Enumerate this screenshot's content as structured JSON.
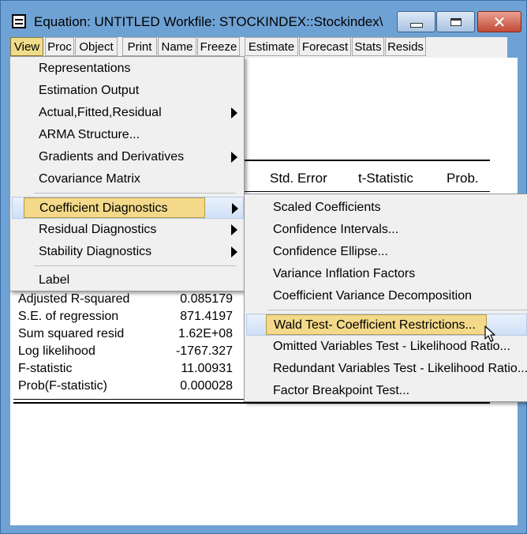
{
  "window": {
    "title": "Equation: UNTITLED   Workfile: STOCKINDEX::Stockindex\\"
  },
  "toolbar": {
    "buttons": [
      "View",
      "Proc",
      "Object",
      "Print",
      "Name",
      "Freeze",
      "Estimate",
      "Forecast",
      "Stats",
      "Resids"
    ],
    "active": "View"
  },
  "table": {
    "headers": [
      "Std. Error",
      "t-Statistic",
      "Prob."
    ],
    "stats": [
      {
        "label": "Adjusted R-squared",
        "value": "0.085179"
      },
      {
        "label": "S.E. of regression",
        "value": "871.4197"
      },
      {
        "label": "Sum squared resid",
        "value": "1.62E+08"
      },
      {
        "label": "Log likelihood",
        "value": "-1767.327"
      },
      {
        "label": "F-statistic",
        "value": "11.00931"
      },
      {
        "label": "Prob(F-statistic)",
        "value": "0.000028"
      }
    ]
  },
  "view_menu": {
    "items": [
      {
        "label": "Representations",
        "submenu": false
      },
      {
        "label": "Estimation Output",
        "submenu": false
      },
      {
        "label": "Actual,Fitted,Residual",
        "submenu": true
      },
      {
        "label": "ARMA Structure...",
        "submenu": false
      },
      {
        "label": "Gradients and Derivatives",
        "submenu": true
      },
      {
        "label": "Covariance Matrix",
        "submenu": false
      },
      {
        "label": "Coefficient Diagnostics",
        "submenu": true,
        "highlighted": true
      },
      {
        "label": "Residual Diagnostics",
        "submenu": true
      },
      {
        "label": "Stability Diagnostics",
        "submenu": true
      },
      {
        "label": "Label",
        "submenu": false
      }
    ]
  },
  "submenu": {
    "items": [
      {
        "label": "Scaled Coefficients"
      },
      {
        "label": "Confidence Intervals..."
      },
      {
        "label": "Confidence Ellipse..."
      },
      {
        "label": "Variance Inflation Factors"
      },
      {
        "label": "Coefficient Variance Decomposition"
      },
      {
        "label": "Wald Test- Coefficient Restrictions...",
        "highlighted": true
      },
      {
        "label": "Omitted Variables Test - Likelihood Ratio..."
      },
      {
        "label": "Redundant Variables Test - Likelihood Ratio..."
      },
      {
        "label": "Factor Breakpoint Test..."
      }
    ]
  },
  "colors": {
    "frame": "#6fa2d4",
    "highlight_gold": "#f3d989",
    "highlight_blue": "#cfe0f6",
    "toolbar_active": "#f0dc8a"
  }
}
